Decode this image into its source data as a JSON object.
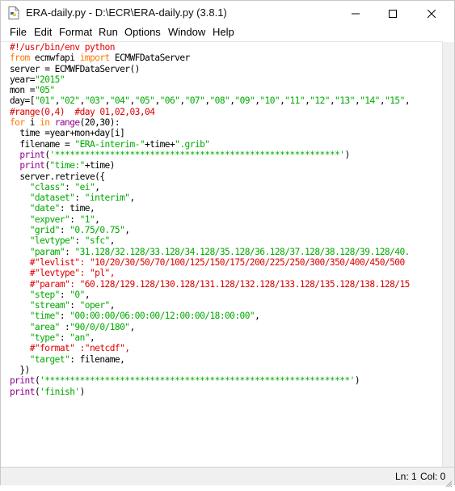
{
  "window": {
    "title": "ERA-daily.py - D:\\ECR\\ERA-daily.py (3.8.1)",
    "app_icon": "python-file-icon",
    "controls": [
      "minimize-icon",
      "maximize-icon",
      "close-icon"
    ]
  },
  "menu": [
    "File",
    "Edit",
    "Format",
    "Run",
    "Options",
    "Window",
    "Help"
  ],
  "code_lines": [
    "#!/usr/bin/env python",
    "from ecmwfapi import ECMWFDataServer",
    "server = ECMWFDataServer()",
    "year=\"2015\"",
    "mon =\"05\"",
    "day=[\"01\",\"02\",\"03\",\"04\",\"05\",\"06\",\"07\",\"08\",\"09\",\"10\",\"11\",\"12\",\"13\",\"14\",\"15\",",
    "#range(0,4)  #day 01,02,03,04",
    "for i in range(20,30):",
    "  time =year+mon+day[i]",
    "  filename = \"ERA-interim-\"+time+\".grib\"",
    "  print('*********************************************************')",
    "  print(\"time:\"+time)",
    "  server.retrieve({",
    "    \"class\": \"ei\",",
    "    \"dataset\": \"interim\",",
    "    \"date\": time,",
    "    \"expver\": \"1\",",
    "    \"grid\": \"0.75/0.75\",",
    "    \"levtype\": \"sfc\",",
    "    \"param\": \"31.128/32.128/33.128/34.128/35.128/36.128/37.128/38.128/39.128/40.",
    "    #\"levlist\": \"10/20/30/50/70/100/125/150/175/200/225/250/300/350/400/450/500",
    "    #\"levtype\": \"pl\",",
    "    #\"param\": \"60.128/129.128/130.128/131.128/132.128/133.128/135.128/138.128/15",
    "    \"step\": \"0\",",
    "    \"stream\": \"oper\",",
    "    \"time\": \"00:00:00/06:00:00/12:00:00/18:00:00\",",
    "    \"area\" :\"90/0/0/180\",",
    "    \"type\": \"an\",",
    "    #\"format\" :\"netcdf\",",
    "    \"target\": filename,",
    "  })",
    "print('*************************************************************')",
    "print('finish')"
  ],
  "status": {
    "line": "Ln: 1",
    "col": "Col: 0"
  }
}
